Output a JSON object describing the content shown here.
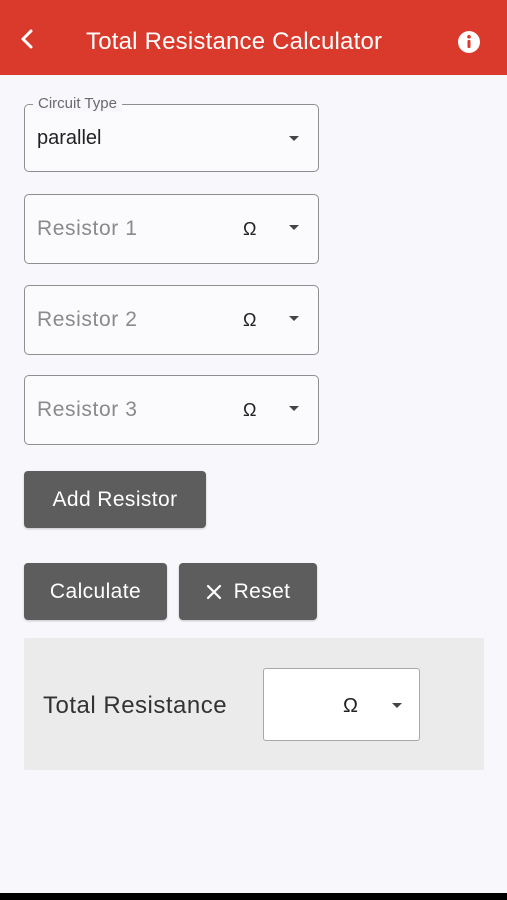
{
  "appbar": {
    "back_icon": "chevron-left-icon",
    "title": "Total Resistance Calculator",
    "info_icon": "info-icon",
    "color": "#d93a2b"
  },
  "form": {
    "circuit_type": {
      "label": "Circuit Type",
      "value": "parallel"
    },
    "resistors": [
      {
        "placeholder": "Resistor 1",
        "unit": "Ω"
      },
      {
        "placeholder": "Resistor 2",
        "unit": "Ω"
      },
      {
        "placeholder": "Resistor 3",
        "unit": "Ω"
      }
    ]
  },
  "buttons": {
    "add_resistor": "Add Resistor",
    "calculate": "Calculate",
    "reset": "Reset",
    "color": "#5d5d5d"
  },
  "result": {
    "label": "Total Resistance",
    "value": "",
    "unit": "Ω"
  }
}
